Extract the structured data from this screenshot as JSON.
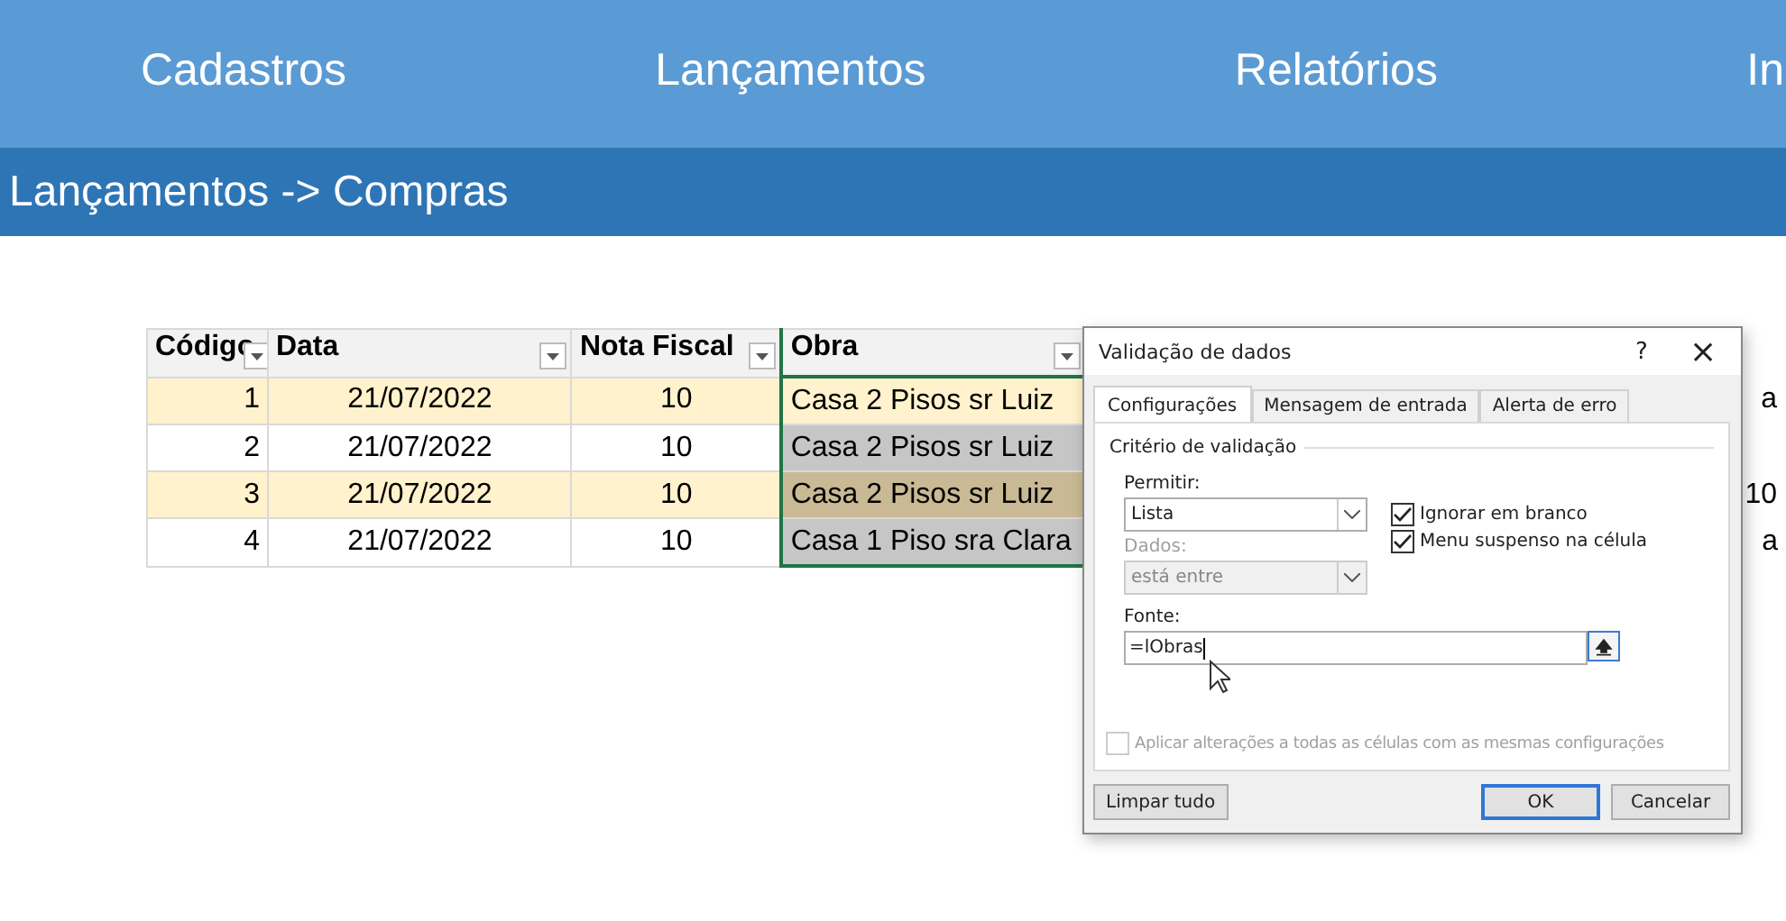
{
  "menu": [
    {
      "label": "Cadastros"
    },
    {
      "label": "Lançamentos"
    },
    {
      "label": "Relatórios"
    },
    {
      "label": "In"
    }
  ],
  "breadcrumb": "Lançamentos -> Compras",
  "table": {
    "columns": [
      "Código",
      "Data",
      "Nota Fiscal",
      "Obra"
    ],
    "rows": [
      {
        "codigo": "1",
        "data": "21/07/2022",
        "nota": "10",
        "obra": "Casa 2 Pisos sr Luiz",
        "selected": false,
        "column_5": "a"
      },
      {
        "codigo": "2",
        "data": "21/07/2022",
        "nota": "10",
        "obra": "Casa 2 Pisos sr Luiz",
        "selected": true,
        "column_5": ""
      },
      {
        "codigo": "3",
        "data": "21/07/2022",
        "nota": "10",
        "obra": "Casa 2 Pisos sr Luiz",
        "selected": true,
        "column_5": "10"
      },
      {
        "codigo": "4",
        "data": "21/07/2022",
        "nota": "10",
        "obra": "Casa 1 Piso sra Clara",
        "selected": true,
        "column_5": "a"
      }
    ]
  },
  "dialog": {
    "title": "Validação de dados",
    "help": "?",
    "close": "×",
    "tabs": [
      {
        "label": "Configurações",
        "selected": true
      },
      {
        "label": "Mensagem de entrada",
        "selected": false
      },
      {
        "label": "Alerta de erro",
        "selected": false
      }
    ],
    "group": "Critério de validação",
    "allow": {
      "label": "Permitir:",
      "value": "Lista",
      "disabled": false
    },
    "data": {
      "label": "Dados:",
      "value": "está entre",
      "disabled": true
    },
    "checks": [
      {
        "label": "Ignorar em branco",
        "checked": true,
        "disabled": false
      },
      {
        "label": "Menu suspenso na célula",
        "checked": true,
        "disabled": false
      }
    ],
    "source": {
      "label": "Fonte:",
      "value": "=lObras"
    },
    "apply": {
      "label": "Aplicar alterações a todas as células com as mesmas configurações",
      "checked": false,
      "disabled": true
    },
    "buttons": [
      {
        "label": "Limpar tudo",
        "default": false
      },
      {
        "label": "OK",
        "default": true
      },
      {
        "label": "Cancelar",
        "default": false
      }
    ]
  }
}
